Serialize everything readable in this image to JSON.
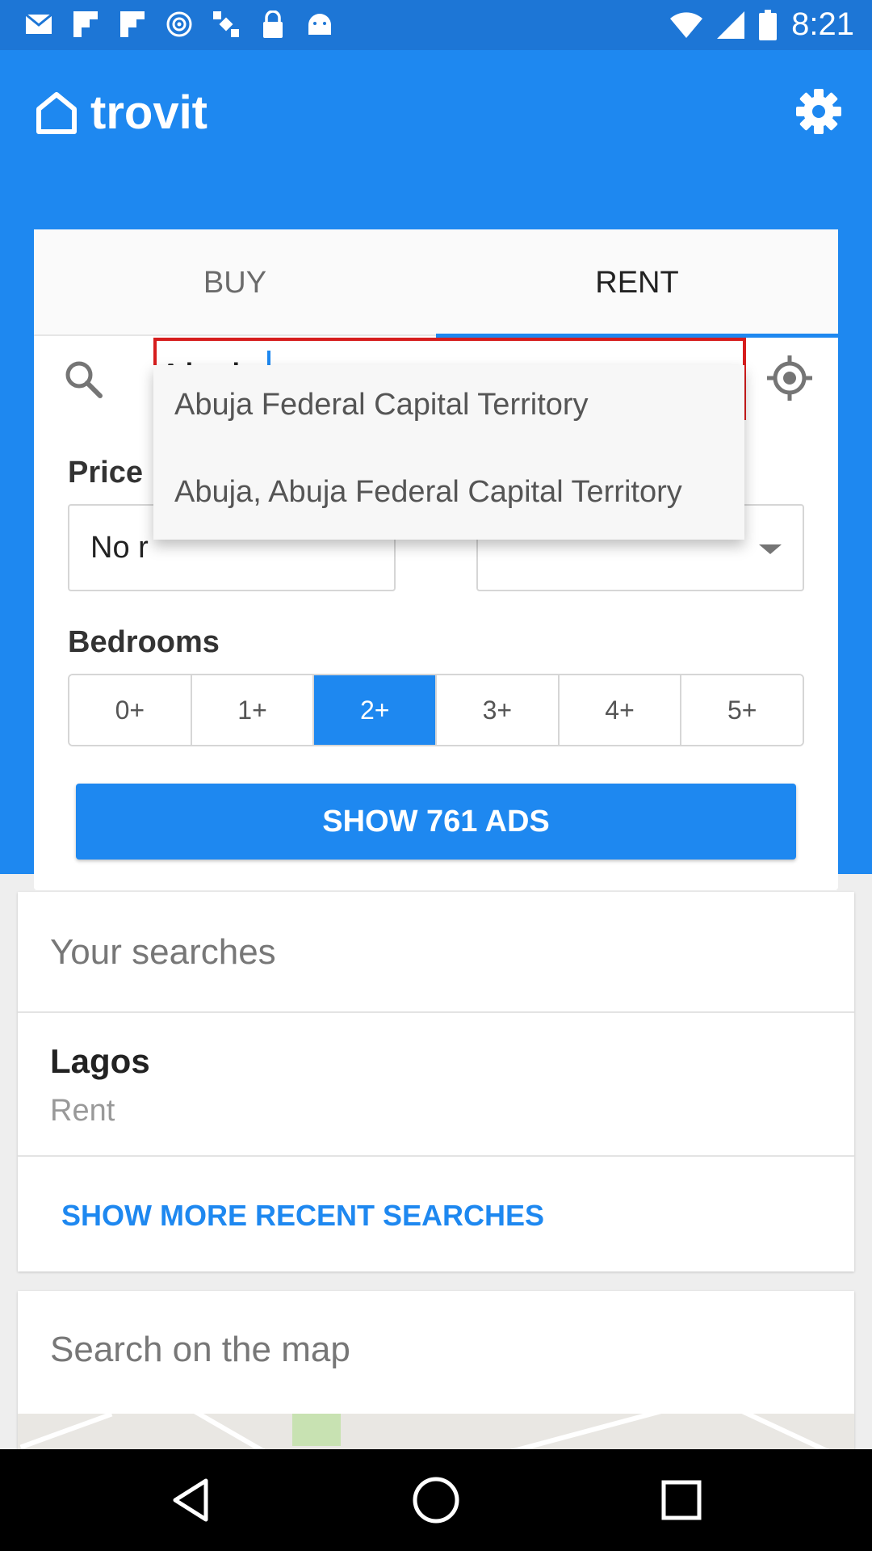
{
  "status_bar": {
    "time": "8:21",
    "icons": [
      "mail-icon",
      "flipboard-icon",
      "flipboard-icon",
      "hotspot-icon",
      "satellite-icon",
      "lock-icon",
      "android-icon"
    ],
    "right_icons": [
      "wifi-icon",
      "signal-icon",
      "battery-icon"
    ]
  },
  "header": {
    "brand": "trovit",
    "brand_icon": "home-icon",
    "settings_icon": "gear-icon"
  },
  "tabs": {
    "buy": "BUY",
    "rent": "RENT",
    "active": "RENT"
  },
  "search": {
    "value": "Abuja",
    "search_icon": "search-icon",
    "locate_icon": "my-location-icon"
  },
  "suggestions": [
    "Abuja Federal Capital Territory",
    "Abuja, Abuja Federal Capital Territory"
  ],
  "price": {
    "label": "Price",
    "min_text": "No r"
  },
  "bedrooms": {
    "label": "Bedrooms",
    "options": [
      "0+",
      "1+",
      "2+",
      "3+",
      "4+",
      "5+"
    ],
    "selected": "2+"
  },
  "show_ads_label": "SHOW 761 ADS",
  "your_searches": {
    "title": "Your searches",
    "items": [
      {
        "title": "Lagos",
        "subtitle": "Rent"
      }
    ],
    "more_label": "SHOW MORE RECENT SEARCHES"
  },
  "map_section": {
    "title": "Search on the map"
  },
  "colors": {
    "primary": "#1e88f0",
    "status_bar": "#1d76d6",
    "highlight_border": "#d61d1d"
  },
  "navigation": [
    "back-icon",
    "home-icon",
    "recents-icon"
  ]
}
